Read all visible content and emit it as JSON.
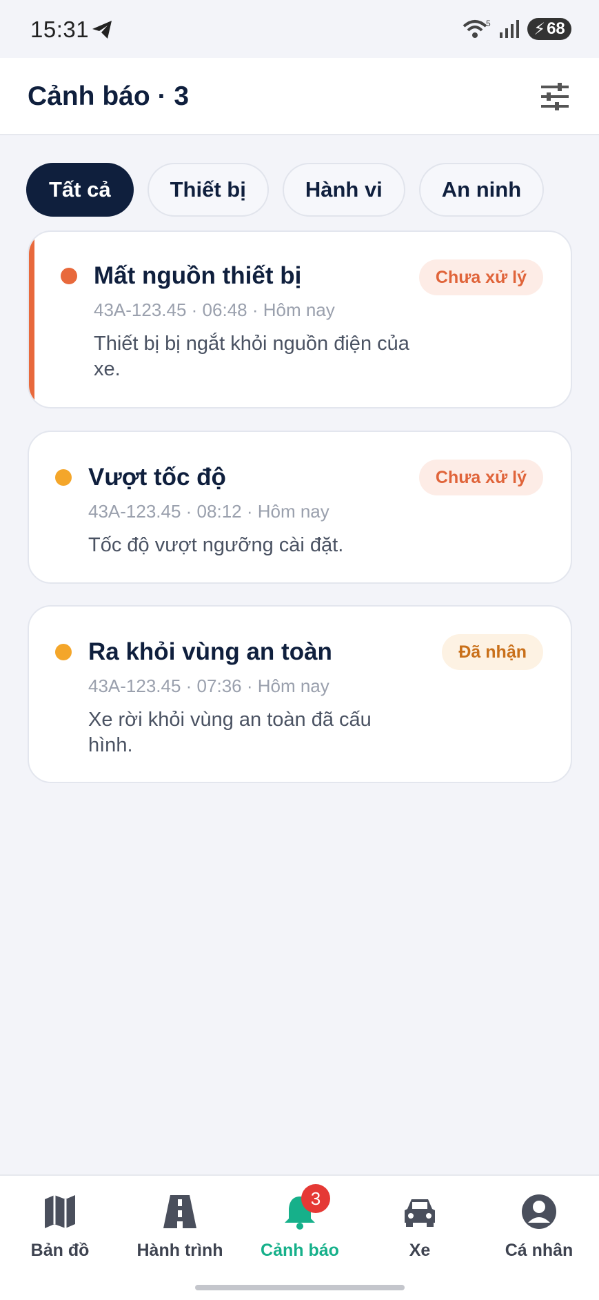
{
  "status_bar": {
    "time": "15:31",
    "network_sup": "5",
    "battery": "68"
  },
  "header": {
    "title": "Cảnh báo · 3"
  },
  "chips": [
    {
      "label": "Tất cả",
      "active": true
    },
    {
      "label": "Thiết bị",
      "active": false
    },
    {
      "label": "Hành vi",
      "active": false
    },
    {
      "label": "An ninh",
      "active": false
    }
  ],
  "alerts": [
    {
      "title": "Mất nguồn thiết bị",
      "meta": "43A-123.45 · 06:48 · Hôm nay",
      "desc": "Thiết bị bị ngắt khỏi nguồn điện của xe.",
      "status": "Chưa xử lý",
      "dot_color": "#e8693c"
    },
    {
      "title": "Vượt tốc độ",
      "meta": "43A-123.45 · 08:12 · Hôm nay",
      "desc": "Tốc độ vượt ngưỡng cài đặt.",
      "status": "Chưa xử lý",
      "dot_color": "#f4a62a"
    },
    {
      "title": "Ra khỏi vùng an toàn",
      "meta": "43A-123.45 · 07:36 · Hôm nay",
      "desc": "Xe rời khỏi vùng an toàn đã cấu hình.",
      "status": "Đã nhận",
      "dot_color": "#f4a62a"
    }
  ],
  "bottom_nav": {
    "map": "Bản đồ",
    "trips": "Hành trình",
    "alerts": "Cảnh báo",
    "alerts_badge": "3",
    "vehicle": "Xe",
    "profile": "Cá nhân"
  },
  "colors": {
    "primary": "#0f1f3d",
    "accent_green": "#16b08a",
    "alert_red": "#e8693c",
    "warn_orange": "#f4a62a"
  }
}
